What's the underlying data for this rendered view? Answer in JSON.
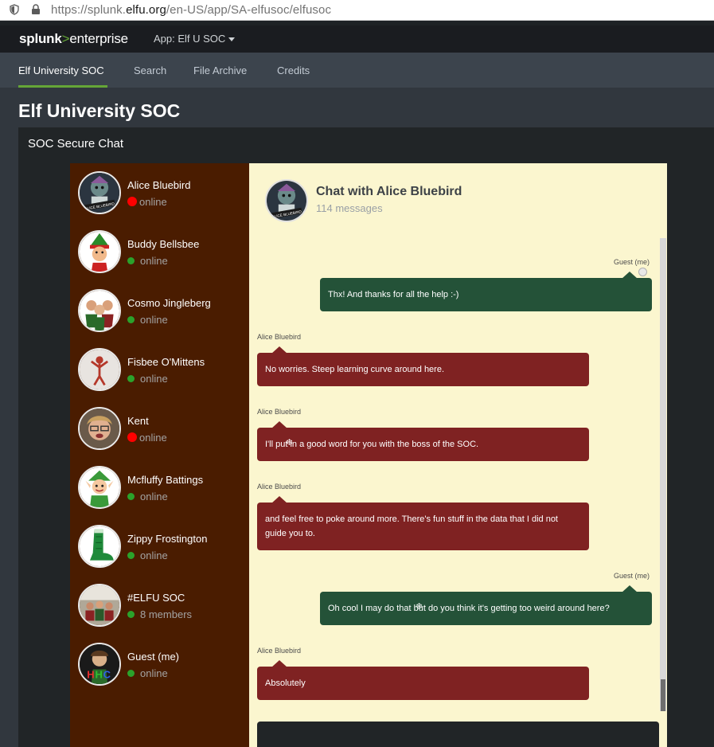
{
  "browser": {
    "url_prefix": "https://splunk.",
    "url_domain": "elfu.org",
    "url_path": "/en-US/app/SA-elfusoc/elfusoc"
  },
  "topbar": {
    "logo_main": "splunk",
    "logo_gt": ">",
    "logo_product": "enterprise",
    "app_menu": "App: Elf U SOC"
  },
  "nav": {
    "tabs": [
      {
        "label": "Elf University SOC",
        "active": true
      },
      {
        "label": "Search",
        "active": false
      },
      {
        "label": "File Archive",
        "active": false
      },
      {
        "label": "Credits",
        "active": false
      }
    ]
  },
  "dashboard": {
    "title": "Elf University SOC",
    "panel_title": "SOC Secure Chat"
  },
  "contacts": [
    {
      "name": "Alice Bluebird",
      "status": "online",
      "status_color": "#ff0000",
      "avatar_icon": "alice-bluebird-avatar"
    },
    {
      "name": "Buddy Bellsbee",
      "status": "online",
      "status_color": "#2ba22b",
      "avatar_icon": "elf-avatar"
    },
    {
      "name": "Cosmo Jingleberg",
      "status": "online",
      "status_color": "#2ba22b",
      "avatar_icon": "elves-group-avatar"
    },
    {
      "name": "Fisbee O'Mittens",
      "status": "online",
      "status_color": "#2ba22b",
      "avatar_icon": "elf-toy-avatar"
    },
    {
      "name": "Kent",
      "status": "online",
      "status_color": "#ff0000",
      "avatar_icon": "kent-avatar"
    },
    {
      "name": "Mcfluffy Battings",
      "status": "online",
      "status_color": "#2ba22b",
      "avatar_icon": "elf-cartoon-avatar"
    },
    {
      "name": "Zippy Frostington",
      "status": "online",
      "status_color": "#2ba22b",
      "avatar_icon": "elf-boot-avatar"
    },
    {
      "name": "#ELFU SOC",
      "status": "8 members",
      "status_color": "#2ba22b",
      "avatar_icon": "group-avatar"
    },
    {
      "name": "Guest (me)",
      "status": "online",
      "status_color": "#2ba22b",
      "avatar_icon": "hhc-avatar"
    }
  ],
  "chat": {
    "title": "Chat with Alice Bluebird",
    "count": "114 messages",
    "messages": [
      {
        "sender": "Guest (me)",
        "direction": "out",
        "text": "Thx! And thanks for all the help :-)"
      },
      {
        "sender": "Alice Bluebird",
        "direction": "in",
        "text": "No worries. Steep learning curve around here."
      },
      {
        "sender": "Alice Bluebird",
        "direction": "in",
        "text": "I'll put in a good word for you with the boss of the SOC."
      },
      {
        "sender": "Alice Bluebird",
        "direction": "in",
        "text": "and feel free to poke around more. There's fun stuff in the data that I did not guide you to."
      },
      {
        "sender": "Guest (me)",
        "direction": "out",
        "text": "Oh cool I may do that but do you think it's getting too weird around here?"
      },
      {
        "sender": "Alice Bluebird",
        "direction": "in",
        "text": "Absolutely"
      }
    ]
  },
  "colors": {
    "sidebar_bg": "#4a1c00",
    "chat_bg": "#fbf6cf",
    "outgoing_bubble": "#245238",
    "incoming_bubble": "#7f2222",
    "online_dot": "#2ba22b",
    "accent": "#65a637"
  }
}
